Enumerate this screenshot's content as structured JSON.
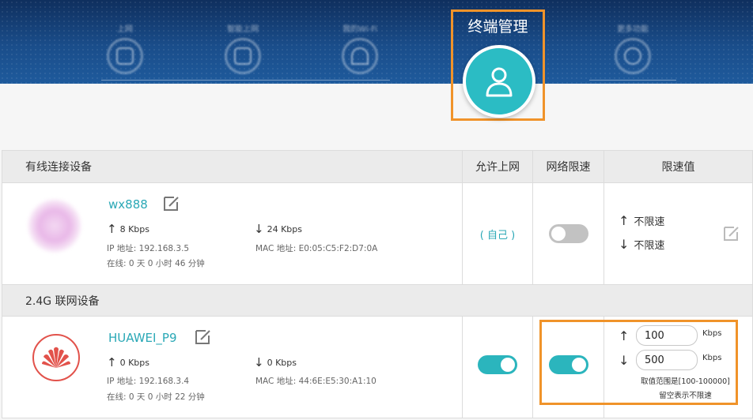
{
  "header": {
    "nav_items": [
      {
        "label": "上网",
        "icon": "globe-icon"
      },
      {
        "label": "智能上网",
        "icon": "router-icon"
      },
      {
        "label": "我的Wi-Fi",
        "icon": "wifi-icon"
      },
      {
        "label": "更多功能",
        "icon": "menu-icon"
      }
    ],
    "active": {
      "label": "终端管理",
      "icon": "user-icon"
    }
  },
  "table": {
    "columns": {
      "device": "有线连接设备",
      "allow": "允许上网",
      "limit": "网络限速",
      "value": "限速值"
    },
    "section_24g": "2.4G 联网设备",
    "wired_device": {
      "name": "wx888",
      "up_rate": "8 Kbps",
      "down_rate": "24 Kbps",
      "ip": "IP 地址: 192.168.3.5",
      "mac": "MAC 地址: E0:05:C5:F2:D7:0A",
      "online": "在线:  0 天 0 小时 46 分钟",
      "allow_text": "( 自己 )",
      "limit_enabled": false,
      "up_limit": "不限速",
      "down_limit": "不限速"
    },
    "wifi_device": {
      "name": "HUAWEI_P9",
      "up_rate": "0 Kbps",
      "down_rate": "0 Kbps",
      "ip": "IP 地址: 192.168.3.4",
      "mac": "MAC 地址: 44:6E:E5:30:A1:10",
      "online": "在线:  0 天 0 小时 22 分钟",
      "allow_enabled": true,
      "limit_enabled": true,
      "up_value": "100",
      "down_value": "500",
      "unit": "Kbps",
      "hint_range": "取值范围是[100-100000]",
      "hint_empty": "留空表示不限速"
    }
  },
  "colors": {
    "accent": "#2bbcc4",
    "highlight": "#f0932a",
    "header": "#1a4d8a",
    "brand_red": "#e2524b"
  }
}
